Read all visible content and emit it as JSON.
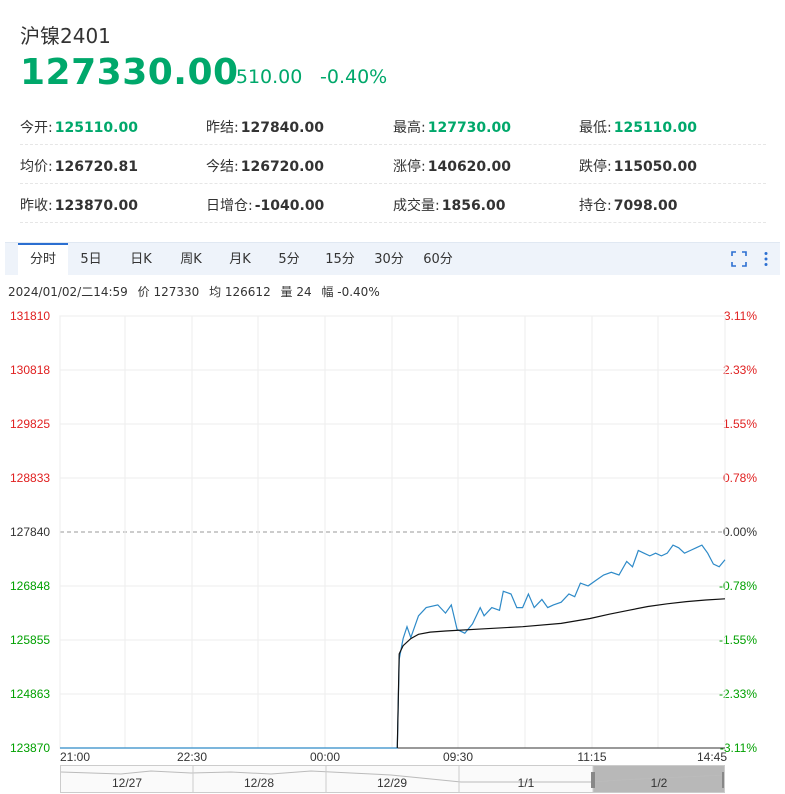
{
  "instrument": {
    "name": "沪镍2401",
    "price": "127330.00",
    "change": "-510.00",
    "change_pct": "-0.40%"
  },
  "stats": [
    [
      {
        "k": "今开:",
        "v": "125110.00",
        "green": true
      },
      {
        "k": "昨结:",
        "v": "127840.00",
        "green": false
      },
      {
        "k": "最高:",
        "v": "127730.00",
        "green": true
      },
      {
        "k": "最低:",
        "v": "125110.00",
        "green": true
      }
    ],
    [
      {
        "k": "均价:",
        "v": "126720.81",
        "green": false
      },
      {
        "k": "今结:",
        "v": "126720.00",
        "green": false
      },
      {
        "k": "涨停:",
        "v": "140620.00",
        "green": false
      },
      {
        "k": "跌停:",
        "v": "115050.00",
        "green": false
      }
    ],
    [
      {
        "k": "昨收:",
        "v": "123870.00",
        "green": false
      },
      {
        "k": "日增仓:",
        "v": "-1040.00",
        "green": false
      },
      {
        "k": "成交量:",
        "v": "1856.00",
        "green": false
      },
      {
        "k": "持仓:",
        "v": "7098.00",
        "green": false
      }
    ]
  ],
  "tabs": [
    "分时",
    "5日",
    "日K",
    "周K",
    "月K",
    "5分",
    "15分",
    "30分",
    "60分"
  ],
  "active_tab": 0,
  "tools": {
    "fullscreen_icon": "fullscreen-icon",
    "more_icon": "more-vertical-icon"
  },
  "info_bar": {
    "datetime": "2024/01/02/二14:59",
    "price": "价 127330",
    "avg": "均 126612",
    "vol": "量 24",
    "range": "幅 -0.40%"
  },
  "colors": {
    "up": "#e02020",
    "down": "#00a000",
    "price_line": "#2e8ac8",
    "avg_line": "#111111",
    "accent": "#00a86b"
  },
  "chart_data": {
    "type": "line",
    "x_ticks": [
      "21:00",
      "22:30",
      "00:00",
      "09:30",
      "11:15",
      "14:45"
    ],
    "y_ticks": [
      "131810",
      "130818",
      "129825",
      "128833",
      "127840",
      "126848",
      "125855",
      "124863",
      "123870"
    ],
    "pct_ticks": [
      "3.11%",
      "2.33%",
      "1.55%",
      "0.78%",
      "0.00%",
      "-0.78%",
      "-1.55%",
      "-2.33%",
      "-3.11%"
    ],
    "ylim": [
      123870,
      131810
    ],
    "prev_settle": 127840,
    "x_range": [
      0,
      345
    ],
    "series": [
      {
        "values": [
          [
            0,
            123870
          ],
          [
            175,
            123870
          ],
          [
            176,
            125500
          ],
          [
            178,
            125880
          ],
          [
            180,
            126100
          ],
          [
            182,
            125900
          ],
          [
            186,
            126300
          ],
          [
            190,
            126450
          ],
          [
            196,
            126500
          ],
          [
            200,
            126350
          ],
          [
            203,
            126500
          ],
          [
            206,
            126050
          ],
          [
            210,
            125980
          ],
          [
            214,
            126150
          ],
          [
            218,
            126450
          ],
          [
            220,
            126300
          ],
          [
            224,
            126450
          ],
          [
            228,
            126400
          ],
          [
            230,
            126750
          ],
          [
            234,
            126700
          ],
          [
            237,
            126450
          ],
          [
            240,
            126450
          ],
          [
            243,
            126700
          ],
          [
            246,
            126450
          ],
          [
            250,
            126600
          ],
          [
            253,
            126450
          ],
          [
            256,
            126500
          ],
          [
            260,
            126550
          ],
          [
            264,
            126700
          ],
          [
            267,
            126650
          ],
          [
            270,
            126900
          ],
          [
            274,
            126850
          ],
          [
            278,
            126950
          ],
          [
            282,
            127050
          ],
          [
            286,
            127100
          ],
          [
            290,
            127050
          ],
          [
            294,
            127300
          ],
          [
            297,
            127200
          ],
          [
            300,
            127500
          ],
          [
            303,
            127450
          ],
          [
            306,
            127400
          ],
          [
            309,
            127450
          ],
          [
            312,
            127400
          ],
          [
            315,
            127450
          ],
          [
            318,
            127600
          ],
          [
            321,
            127550
          ],
          [
            324,
            127450
          ],
          [
            327,
            127500
          ],
          [
            330,
            127550
          ],
          [
            333,
            127600
          ],
          [
            336,
            127450
          ],
          [
            339,
            127250
          ],
          [
            342,
            127200
          ],
          [
            345,
            127330
          ]
        ]
      },
      {
        "values": [
          [
            175,
            123870
          ],
          [
            176,
            125600
          ],
          [
            178,
            125750
          ],
          [
            182,
            125880
          ],
          [
            186,
            125960
          ],
          [
            192,
            126000
          ],
          [
            200,
            126020
          ],
          [
            220,
            126060
          ],
          [
            240,
            126100
          ],
          [
            260,
            126160
          ],
          [
            275,
            126250
          ],
          [
            285,
            126330
          ],
          [
            295,
            126400
          ],
          [
            305,
            126470
          ],
          [
            315,
            126520
          ],
          [
            325,
            126560
          ],
          [
            335,
            126590
          ],
          [
            345,
            126612
          ]
        ]
      }
    ]
  },
  "navigator": {
    "labels": [
      "12/27",
      "12/28",
      "12/29",
      "1/1",
      "1/2"
    ]
  }
}
